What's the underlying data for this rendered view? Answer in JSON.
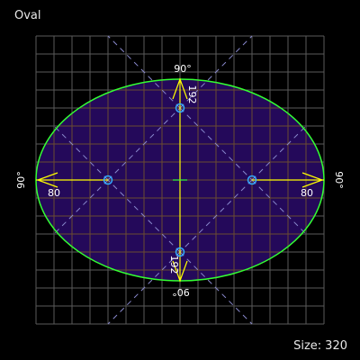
{
  "title": "Oval",
  "size": {
    "label": "Size:",
    "value": "320"
  },
  "colors": {
    "background": "#000000",
    "grid": "#5a5a5a",
    "fill": "#2a0a6a",
    "outline": "#33ff33",
    "guides": "#ffff00",
    "handles": "#33aaff",
    "text": "#ffffff"
  },
  "angles": {
    "top": "90°",
    "bottom": "90°",
    "left": "90°",
    "right": "90°"
  },
  "distances": {
    "top": "192",
    "bottom": "192",
    "left": "80",
    "right": "80"
  }
}
